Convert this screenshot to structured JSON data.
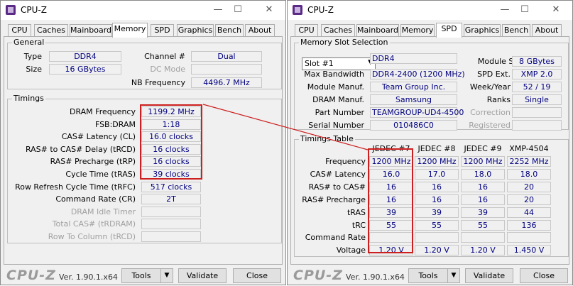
{
  "app": {
    "title": "CPU-Z",
    "logo": "CPU-Z",
    "version": "Ver. 1.90.1.x64",
    "tabs": [
      "CPU",
      "Caches",
      "Mainboard",
      "Memory",
      "SPD",
      "Graphics",
      "Bench",
      "About"
    ],
    "buttons": {
      "tools": "Tools",
      "validate": "Validate",
      "close": "Close"
    },
    "window_controls": {
      "minimize": "—",
      "maximize": "☐",
      "close": "✕"
    },
    "dropdown_arrow": "▼"
  },
  "memory": {
    "general_label": "General",
    "type_label": "Type",
    "type": "DDR4",
    "size_label": "Size",
    "size": "16 GBytes",
    "channel_label": "Channel #",
    "channel": "Dual",
    "dc_mode_label": "DC Mode",
    "dc_mode": "",
    "nb_freq_label": "NB Frequency",
    "nb_freq": "4496.7 MHz",
    "timings_label": "Timings",
    "rows": [
      {
        "label": "DRAM Frequency",
        "value": "1199.2 MHz",
        "enabled": true
      },
      {
        "label": "FSB:DRAM",
        "value": "1:18",
        "enabled": true
      },
      {
        "label": "CAS# Latency (CL)",
        "value": "16.0 clocks",
        "enabled": true
      },
      {
        "label": "RAS# to CAS# Delay (tRCD)",
        "value": "16 clocks",
        "enabled": true
      },
      {
        "label": "RAS# Precharge (tRP)",
        "value": "16 clocks",
        "enabled": true
      },
      {
        "label": "Cycle Time (tRAS)",
        "value": "39 clocks",
        "enabled": true
      },
      {
        "label": "Row Refresh Cycle Time (tRFC)",
        "value": "517 clocks",
        "enabled": true
      },
      {
        "label": "Command Rate (CR)",
        "value": "2T",
        "enabled": true
      },
      {
        "label": "DRAM Idle Timer",
        "value": "",
        "enabled": false
      },
      {
        "label": "Total CAS# (tRDRAM)",
        "value": "",
        "enabled": false
      },
      {
        "label": "Row To Column (tRCD)",
        "value": "",
        "enabled": false
      }
    ]
  },
  "spd": {
    "slot_group_label": "Memory Slot Selection",
    "slot": "Slot #1",
    "type": "DDR4",
    "max_bw_label": "Max Bandwidth",
    "max_bw": "DDR4-2400 (1200 MHz)",
    "module_manuf_label": "Module Manuf.",
    "module_manuf": "Team Group Inc.",
    "dram_manuf_label": "DRAM Manuf.",
    "dram_manuf": "Samsung",
    "part_label": "Part Number",
    "part": "TEAMGROUP-UD4-4500",
    "serial_label": "Serial Number",
    "serial": "010486C0",
    "module_size_label": "Module Size",
    "module_size": "8 GBytes",
    "spd_ext_label": "SPD Ext.",
    "spd_ext": "XMP 2.0",
    "week_year_label": "Week/Year",
    "week_year": "52 / 19",
    "ranks_label": "Ranks",
    "ranks": "Single",
    "correction_label": "Correction",
    "correction": "",
    "registered_label": "Registered",
    "registered": "",
    "table_label": "Timings Table",
    "columns": [
      "JEDEC #7",
      "JEDEC #8",
      "JEDEC #9",
      "XMP-4504"
    ],
    "rows": [
      {
        "label": "Frequency",
        "values": [
          "1200 MHz",
          "1200 MHz",
          "1200 MHz",
          "2252 MHz"
        ]
      },
      {
        "label": "CAS# Latency",
        "values": [
          "16.0",
          "17.0",
          "18.0",
          "18.0"
        ]
      },
      {
        "label": "RAS# to CAS#",
        "values": [
          "16",
          "16",
          "16",
          "20"
        ]
      },
      {
        "label": "RAS# Precharge",
        "values": [
          "16",
          "16",
          "16",
          "20"
        ]
      },
      {
        "label": "tRAS",
        "values": [
          "39",
          "39",
          "39",
          "44"
        ]
      },
      {
        "label": "tRC",
        "values": [
          "55",
          "55",
          "55",
          "136"
        ]
      },
      {
        "label": "Command Rate",
        "values": [
          "",
          "",
          "",
          ""
        ]
      },
      {
        "label": "Voltage",
        "values": [
          "1.20 V",
          "1.20 V",
          "1.20 V",
          "1.450 V"
        ]
      }
    ]
  },
  "colors": {
    "highlight": "#cc1f1f",
    "value_text": "#000080"
  }
}
